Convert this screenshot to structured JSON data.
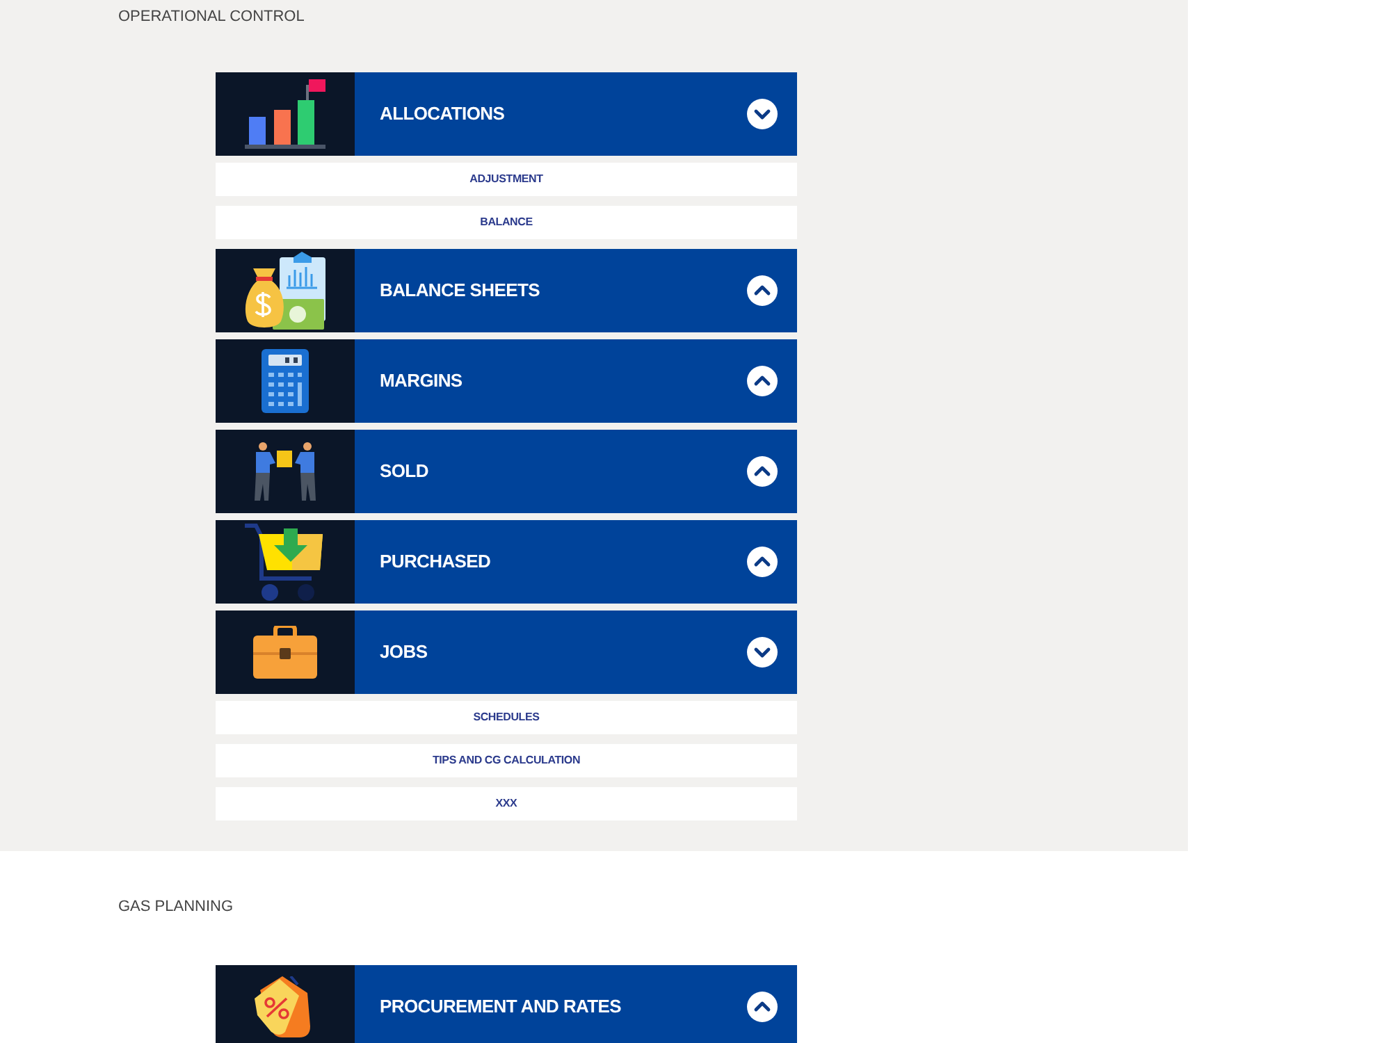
{
  "sections": [
    {
      "title": "OPERATIONAL CONTROL",
      "groups": [
        {
          "title": "ALLOCATIONS",
          "expanded": true,
          "items": [
            "ADJUSTMENT",
            "BALANCE"
          ]
        },
        {
          "title": "BALANCE SHEETS",
          "expanded": false
        },
        {
          "title": "MARGINS",
          "expanded": false
        },
        {
          "title": "SOLD",
          "expanded": false
        },
        {
          "title": "PURCHASED",
          "expanded": false
        },
        {
          "title": "JOBS",
          "expanded": true,
          "items": [
            "SCHEDULES",
            "TIPS AND CG CALCULATION",
            "XXX"
          ]
        }
      ]
    },
    {
      "title": "GAS PLANNING",
      "groups": [
        {
          "title": "PROCUREMENT AND RATES",
          "expanded": false
        }
      ]
    }
  ]
}
